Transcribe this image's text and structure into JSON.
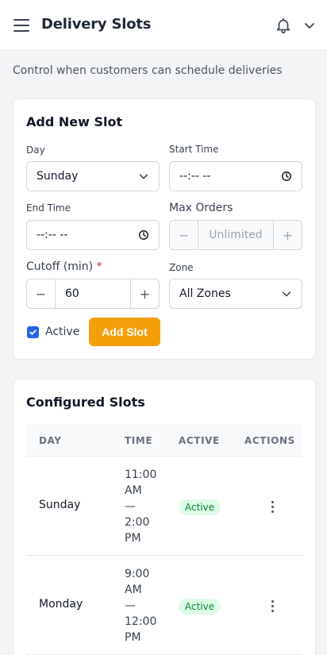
{
  "header": {
    "title": "Delivery Slots"
  },
  "subtitle": "Control when customers can schedule deliveries",
  "add_form": {
    "title": "Add New Slot",
    "day_label": "Day",
    "day_value": "Sunday",
    "start_label": "Start Time",
    "start_value": "--:-- --",
    "end_label": "End Time",
    "end_value": "--:-- --",
    "max_label": "Max Orders",
    "max_placeholder": "Unlimited",
    "cutoff_label": "Cutoff (min)",
    "cutoff_required": "*",
    "cutoff_value": "60",
    "zone_label": "Zone",
    "zone_value": "All Zones",
    "active_label": "Active",
    "active_checked": true,
    "submit_label": "Add Slot",
    "minus": "−",
    "plus": "+"
  },
  "slots": {
    "title": "Configured Slots",
    "columns": [
      "DAY",
      "TIME",
      "ACTIVE",
      "ACTIONS"
    ],
    "rows": [
      {
        "day": "Sunday",
        "time_lines": [
          "11:00",
          "AM",
          "—",
          "2:00",
          "PM"
        ],
        "status": "Active"
      },
      {
        "day": "Monday",
        "time_lines": [
          "9:00",
          "AM",
          "—",
          "12:00",
          "PM"
        ],
        "status": "Active"
      }
    ]
  },
  "colors": {
    "accent": "#f59e0b",
    "checkbox": "#2563eb",
    "badge_bg": "#dcfce7",
    "badge_text": "#15803d"
  }
}
